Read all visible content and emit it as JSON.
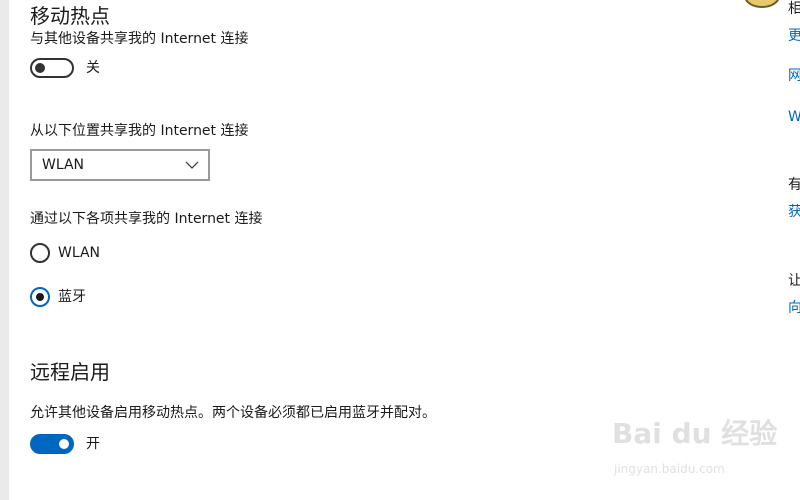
{
  "hotspot": {
    "title": "移动热点",
    "share_desc": "与其他设备共享我的 Internet 连接",
    "toggle_state": "关",
    "toggle_on": false
  },
  "share_from": {
    "label": "从以下位置共享我的 Internet 连接",
    "selected": "WLAN"
  },
  "share_over": {
    "label": "通过以下各项共享我的 Internet 连接",
    "options": [
      {
        "label": "WLAN",
        "checked": false
      },
      {
        "label": "蓝牙",
        "checked": true
      }
    ]
  },
  "remote": {
    "title": "远程启用",
    "desc": "允许其他设备启用移动热点。两个设备必须都已启用蓝牙并配对。",
    "toggle_state": "开",
    "toggle_on": true
  },
  "right_column": {
    "items": [
      {
        "text": "相",
        "kind": "text"
      },
      {
        "text": "更",
        "kind": "link"
      },
      {
        "text": "网",
        "kind": "link"
      },
      {
        "text": "W",
        "kind": "link"
      },
      {
        "text": "有",
        "kind": "text"
      },
      {
        "text": "获",
        "kind": "link"
      },
      {
        "text": "让",
        "kind": "text"
      },
      {
        "text": "向",
        "kind": "link"
      }
    ]
  },
  "watermark": {
    "brand": "Bai du 经验",
    "url": "jingyan.baidu.com"
  },
  "colors": {
    "accent": "#0067c0",
    "text": "#1a1a1a",
    "background": "#ffffff"
  }
}
